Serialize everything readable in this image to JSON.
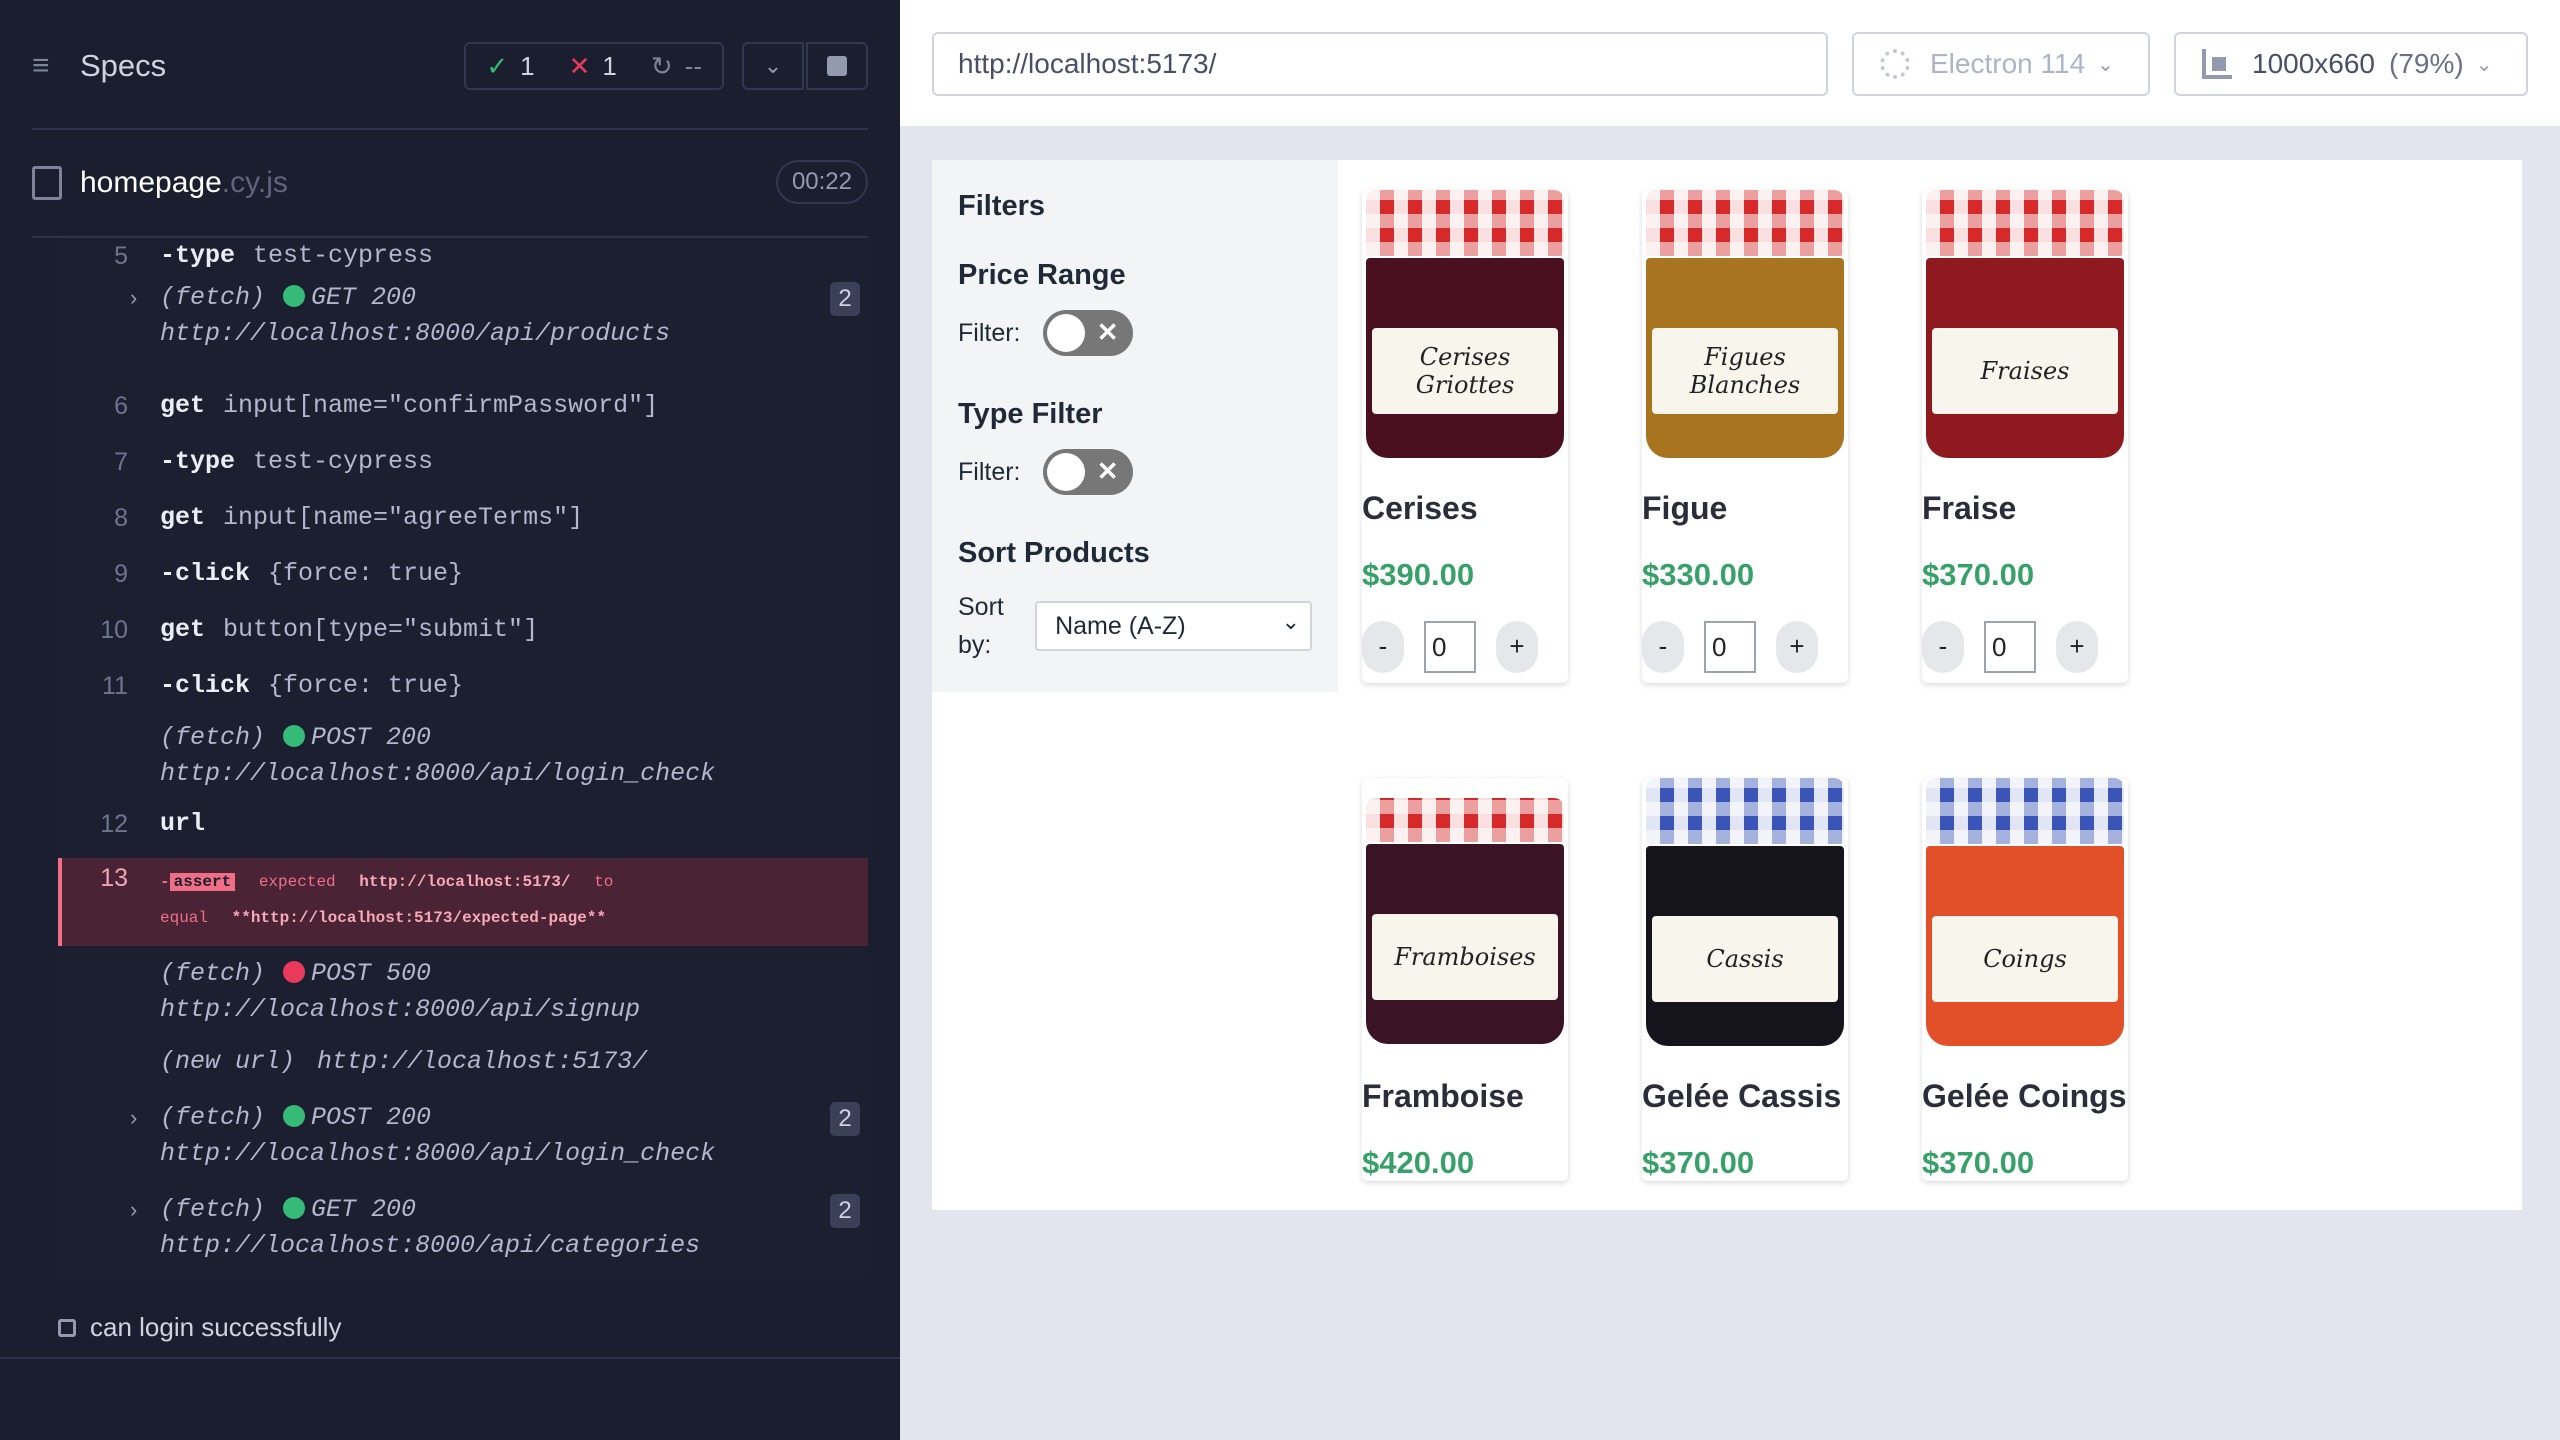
{
  "runner": {
    "specs_label": "Specs",
    "stats": {
      "passed": "1",
      "failed": "1",
      "pending": "--"
    },
    "file": {
      "name": "homepage",
      "ext": ".cy.js",
      "duration": "00:22"
    },
    "log": [
      {
        "line": "5",
        "cmd": "-type",
        "arg": "test-cypress"
      },
      {
        "method": "(fetch)",
        "status": "GET 200",
        "url": "http://localhost:8000/api/products",
        "count": "2"
      },
      {
        "line": "6",
        "cmd": "get",
        "arg": "input[name=\"confirmPassword\"]"
      },
      {
        "line": "7",
        "cmd": "-type",
        "arg": "test-cypress"
      },
      {
        "line": "8",
        "cmd": "get",
        "arg": "input[name=\"agreeTerms\"]"
      },
      {
        "line": "9",
        "cmd": "-click",
        "arg": "{force: true}"
      },
      {
        "line": "10",
        "cmd": "get",
        "arg": "button[type=\"submit\"]"
      },
      {
        "line": "11",
        "cmd": "-click",
        "arg": "{force: true}"
      },
      {
        "method": "(fetch)",
        "status": "POST 200",
        "url": "http://localhost:8000/api/login_check"
      },
      {
        "line": "12",
        "cmd": "url"
      },
      {
        "line": "13",
        "cmd": "-",
        "tag": "assert",
        "w1": "expected",
        "v1": "http://localhost:5173/",
        "w2": "to",
        "w3": "equal",
        "v2": "**http://localhost:5173/expected-page**"
      },
      {
        "method": "(fetch)",
        "status": "POST 500",
        "url": "http://localhost:8000/api/signup"
      },
      {
        "method": "(new url)",
        "url": "http://localhost:5173/"
      },
      {
        "method": "(fetch)",
        "status": "POST 200",
        "url": "http://localhost:8000/api/login_check",
        "count": "2"
      },
      {
        "method": "(fetch)",
        "status": "GET 200",
        "url": "http://localhost:8000/api/categories",
        "count": "2"
      }
    ],
    "next_test": "can login successfully"
  },
  "browser": {
    "url": "http://localhost:5173/",
    "name": "Electron 114",
    "viewport": "1000x660",
    "scale": "(79%)"
  },
  "app": {
    "filters_title": "Filters",
    "price_range": "Price Range",
    "type_filter": "Type Filter",
    "filter_label": "Filter:",
    "sort_title": "Sort Products",
    "sort_label": "Sort by:",
    "sort_value": "Name (A-Z)",
    "products": [
      {
        "name": "Cerises",
        "price": "$390.00",
        "qty": "0",
        "jar_label": "Cerises Griottes"
      },
      {
        "name": "Figue",
        "price": "$330.00",
        "qty": "0",
        "jar_label": "Figues Blanches"
      },
      {
        "name": "Fraise",
        "price": "$370.00",
        "qty": "0",
        "jar_label": "Fraises"
      },
      {
        "name": "Framboise",
        "price": "$420.00",
        "jar_label": "Framboises"
      },
      {
        "name": "Gelée Cassis",
        "price": "$370.00",
        "jar_label": "Cassis"
      },
      {
        "name": "Gelée Coings",
        "price": "$370.00",
        "jar_label": "Coings"
      }
    ],
    "colors": {
      "price": "#38a169",
      "pass": "#35bb77",
      "fail": "#ea3a5c"
    }
  }
}
